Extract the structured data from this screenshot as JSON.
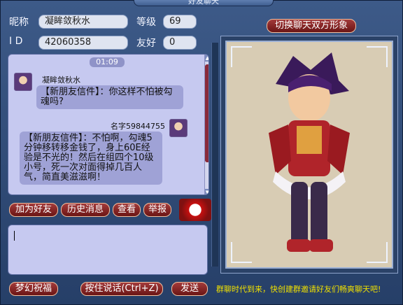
{
  "window": {
    "title": "好友聊天"
  },
  "profile": {
    "nickname_label": "昵称",
    "nickname_value": "凝眸敛秋水",
    "level_label": "等级",
    "level_value": "69",
    "id_label": "I D",
    "id_value": "42060358",
    "friend_label": "友好",
    "friend_value": "0"
  },
  "chat": {
    "timestamp": "01:09",
    "msg1_sender": "凝眸敛秋水",
    "msg1_text": "【新朋友信件】：你这样不怕被勾魂吗?",
    "msg2_sender": "名字59844755",
    "msg2_text": "【新朋友信件】：不怕啊，勾魂5分钟移转移金钱了，身上60E经验是不光的！然后在组四个10级小号，死一次对面得掉几百人气，简直美滋滋啊！"
  },
  "actions": {
    "add_friend": "加为好友",
    "history": "历史消息",
    "view": "查看",
    "report": "举报"
  },
  "bottom": {
    "wish": "梦幻祝福",
    "hold_to_talk": "按住说话(Ctrl+Z)",
    "send": "发送"
  },
  "portrait": {
    "switch_label": "切换聊天双方形象"
  },
  "footer": {
    "notice": "群聊时代到来，快创建群邀请好友们畅爽聊天吧!"
  },
  "colors": {
    "accent_red": "#8a2020",
    "panel": "#c6c9f0",
    "notice": "#f0e000"
  }
}
